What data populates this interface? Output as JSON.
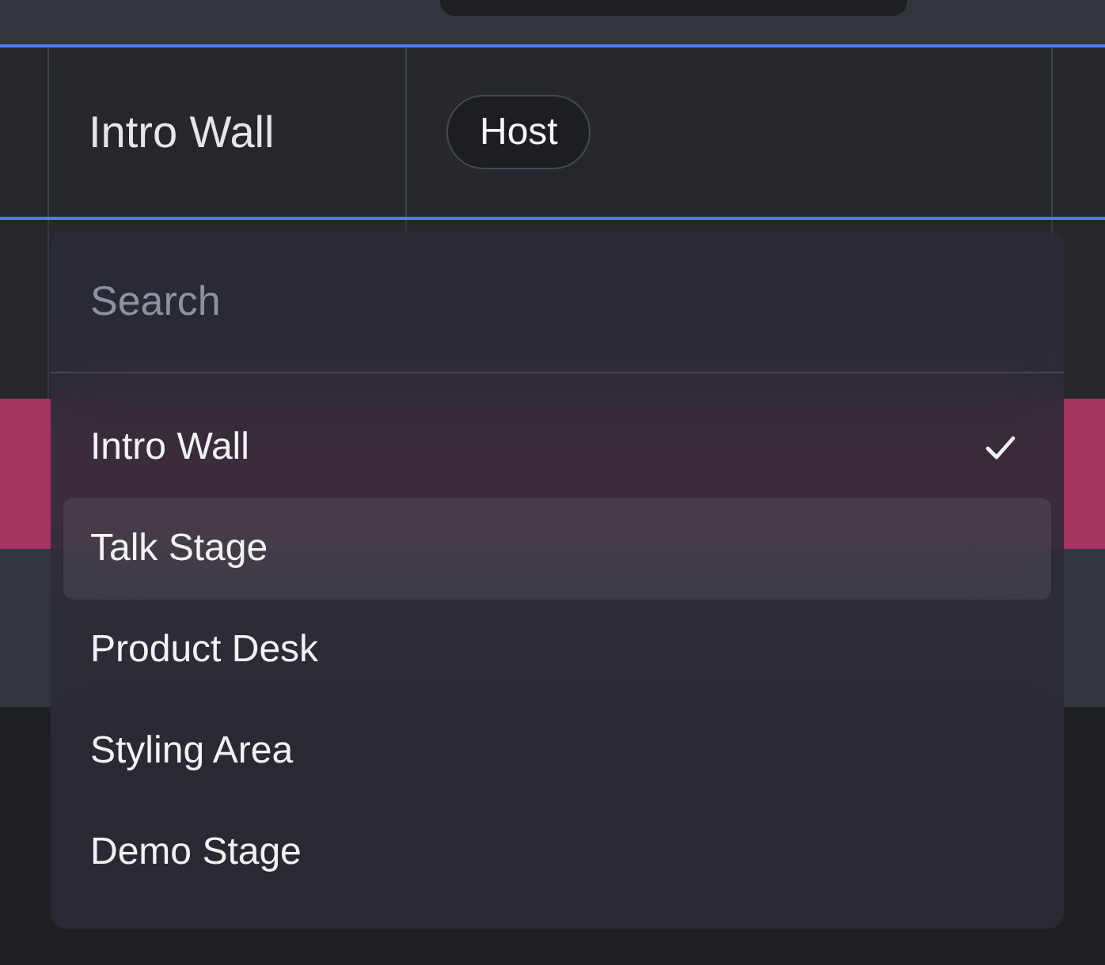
{
  "table": {
    "rows": [
      {
        "name": "Intro Wall",
        "tag": "Host",
        "selected": true
      }
    ]
  },
  "dropdown": {
    "search": {
      "placeholder": "Search"
    },
    "options": [
      {
        "label": "Intro Wall",
        "selected": true,
        "hovered": false
      },
      {
        "label": "Talk Stage",
        "selected": false,
        "hovered": true
      },
      {
        "label": "Product Desk",
        "selected": false,
        "hovered": false
      },
      {
        "label": "Styling Area",
        "selected": false,
        "hovered": false
      },
      {
        "label": "Demo Stage",
        "selected": false,
        "hovered": false
      }
    ]
  }
}
